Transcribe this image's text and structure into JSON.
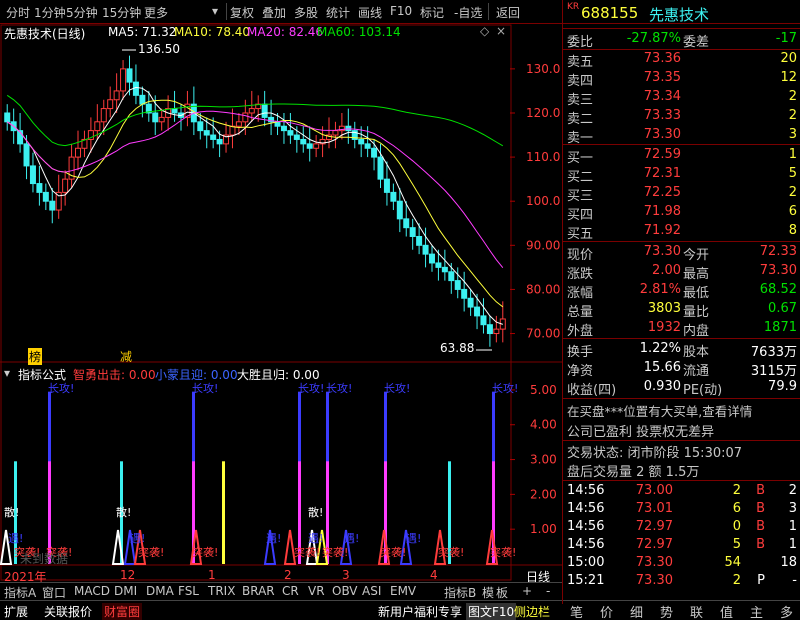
{
  "toolbar": {
    "items": [
      "分时",
      "1分钟",
      "5分钟",
      "15分钟",
      "更多",
      "复权",
      "叠加",
      "多股",
      "统计",
      "画线",
      "F10",
      "标记",
      "-自选",
      "返回"
    ]
  },
  "chart_header": {
    "title": "先惠技术(日线)",
    "ma5": "MA5: 71.32",
    "ma10": "MA10: 78.40",
    "ma20": "MA20: 82.46",
    "ma60": "MA60: 103.14"
  },
  "chart_labels": {
    "high_marker": "136.50",
    "low_marker": "63.88",
    "bang": "榜",
    "jian": "减"
  },
  "indicator_header": {
    "name": "指标公式",
    "s1": "智勇出击: 0.00",
    "s2": "小蒙且迎: 0.00",
    "s3": "大胜且归: 0.00"
  },
  "indicator_labels": {
    "changgong": "长攻!",
    "san": "散!",
    "tu": "突袭!",
    "yu": "遇!",
    "watermark": "未到数据"
  },
  "x_axis": {
    "year": "2021年",
    "m12": "12",
    "m1": "1",
    "m2": "2",
    "m3": "3",
    "m4": "4",
    "period": "日线"
  },
  "bottom_tabs": [
    "指标A",
    "窗口",
    "MACD",
    "DMI",
    "DMA",
    "FSL",
    "TRIX",
    "BRAR",
    "CR",
    "VR",
    "OBV",
    "ASI",
    "EMV",
    "指标B",
    "模",
    "板",
    "+",
    "-"
  ],
  "status_bar": {
    "items": [
      "扩展",
      "关联报价",
      "财富圈"
    ],
    "right": [
      "新用户福利专享",
      "图文F10",
      "侧边栏"
    ]
  },
  "stock": {
    "code": "688155",
    "name": "先惠技术",
    "prefix": "KR",
    "weibi_label": "委比",
    "weibi": "-27.87%",
    "weicha_label": "委差",
    "weicha": "-17"
  },
  "asks": [
    {
      "label": "卖五",
      "price": "73.36",
      "vol": "20"
    },
    {
      "label": "卖四",
      "price": "73.35",
      "vol": "12"
    },
    {
      "label": "卖三",
      "price": "73.34",
      "vol": "2"
    },
    {
      "label": "卖二",
      "price": "73.33",
      "vol": "2"
    },
    {
      "label": "卖一",
      "price": "73.30",
      "vol": "3"
    }
  ],
  "bids": [
    {
      "label": "买一",
      "price": "72.59",
      "vol": "1"
    },
    {
      "label": "买二",
      "price": "72.31",
      "vol": "5"
    },
    {
      "label": "买三",
      "price": "72.25",
      "vol": "2"
    },
    {
      "label": "买四",
      "price": "71.98",
      "vol": "6"
    },
    {
      "label": "买五",
      "price": "71.92",
      "vol": "8"
    }
  ],
  "quote": [
    {
      "l1": "现价",
      "v1": "73.30",
      "l2": "今开",
      "v2": "72.33",
      "c1": "red",
      "c2": "red"
    },
    {
      "l1": "涨跌",
      "v1": "2.00",
      "l2": "最高",
      "v2": "73.30",
      "c1": "red",
      "c2": "red"
    },
    {
      "l1": "涨幅",
      "v1": "2.81%",
      "l2": "最低",
      "v2": "68.52",
      "c1": "red",
      "c2": "green"
    },
    {
      "l1": "总量",
      "v1": "3803",
      "l2": "量比",
      "v2": "0.67",
      "c1": "yellow",
      "c2": "green"
    },
    {
      "l1": "外盘",
      "v1": "1932",
      "l2": "内盘",
      "v2": "1871",
      "c1": "red",
      "c2": "green"
    }
  ],
  "stats": [
    {
      "l1": "换手",
      "v1": "1.22%",
      "l2": "股本",
      "v2": "7633万"
    },
    {
      "l1": "净资",
      "v1": "15.66",
      "l2": "流通",
      "v2": "3115万"
    },
    {
      "l1": "收益(四)",
      "v1": "0.930",
      "l2": "PE(动)",
      "v2": "79.9"
    }
  ],
  "info_lines": [
    "在买盘***位置有大买单,查看详情",
    "公司已盈利 投票权无差异"
  ],
  "trade_status": "交易状态: 闭市阶段 15:30:07",
  "after_hours": "盘后交易量 2 额 1.5万",
  "ticks": [
    {
      "time": "14:56",
      "price": "73.00",
      "vol": "2",
      "side": "B",
      "n": "2"
    },
    {
      "time": "14:56",
      "price": "73.01",
      "vol": "6",
      "side": "B",
      "n": "3"
    },
    {
      "time": "14:56",
      "price": "72.97",
      "vol": "0",
      "side": "B",
      "n": "1"
    },
    {
      "time": "14:56",
      "price": "72.97",
      "vol": "5",
      "side": "B",
      "n": "1"
    },
    {
      "time": "15:00",
      "price": "73.30",
      "vol": "54",
      "side": "",
      "n": "18"
    },
    {
      "time": "15:21",
      "price": "73.30",
      "vol": "2",
      "side": "P",
      "n": "-"
    }
  ],
  "rp_tabs": [
    "笔",
    "价",
    "细",
    "势",
    "联",
    "值",
    "主",
    "多"
  ],
  "chart_data": {
    "type": "candlestick",
    "y_ticks": [
      130.0,
      120.0,
      110.0,
      100.0,
      90.0,
      80.0,
      70.0
    ],
    "y_tick_labels": [
      "130.0",
      "120.0",
      "110.0",
      "100.0",
      "90.00",
      "80.00",
      "70.00"
    ],
    "ylim": [
      64,
      137
    ],
    "ind_y_ticks": [
      1,
      2,
      3,
      4,
      5
    ],
    "ind_y_tick_labels": [
      "1.00",
      "2.00",
      "3.00",
      "4.00",
      "5.00"
    ],
    "closes": [
      118,
      116,
      113,
      108,
      104,
      102,
      100,
      98,
      102,
      105,
      110,
      112,
      114,
      116,
      118,
      121,
      123,
      125,
      130,
      127,
      124,
      122,
      120,
      118,
      119,
      121,
      120,
      119,
      122,
      118,
      116,
      115,
      114,
      113,
      115,
      117,
      118,
      120,
      121,
      122,
      119,
      118,
      117,
      116,
      115,
      114,
      113,
      112,
      113,
      114,
      115,
      116,
      117,
      116,
      114,
      113,
      112,
      110,
      105,
      102,
      100,
      96,
      94,
      92,
      90,
      88,
      86,
      85,
      84,
      82,
      80,
      78,
      76,
      74,
      72,
      70,
      71,
      73.3
    ]
  },
  "colors": {
    "ma5": "#ffffff",
    "ma10": "#ffff3c",
    "ma20": "#ff3cff",
    "ma60": "#00e000",
    "up": "#ff3c3c",
    "down": "#3cf0f0",
    "border": "#7a0000"
  }
}
